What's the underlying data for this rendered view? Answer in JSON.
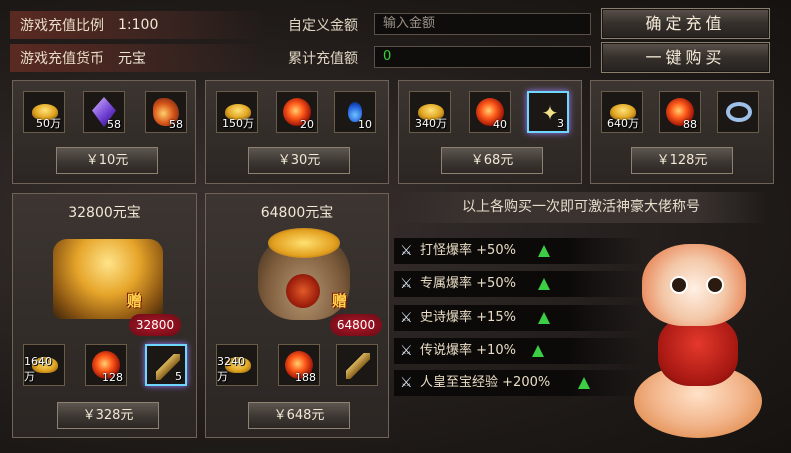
{
  "header": {
    "ratio_label": "游戏充值比例",
    "ratio_value": "1:100",
    "currency_label": "游戏充值货币",
    "currency_value": "元宝",
    "custom_amount_label": "自定义金额",
    "custom_amount_placeholder": "输入金额",
    "total_label": "累计充值额",
    "total_value": "0",
    "confirm_button": "确定充值",
    "buy_all_button": "一键购买"
  },
  "top_packs": [
    {
      "items": [
        {
          "icon": "gold-ingot-icon",
          "count": "50万"
        },
        {
          "icon": "purple-crystal-icon",
          "count": "58"
        },
        {
          "icon": "flame-orb-icon",
          "count": "58"
        }
      ],
      "price": "￥10元"
    },
    {
      "items": [
        {
          "icon": "gold-ingot-icon",
          "count": "150万"
        },
        {
          "icon": "fire-orb-icon",
          "count": "20"
        },
        {
          "icon": "blue-potion-icon",
          "count": "10"
        }
      ],
      "price": "￥30元"
    },
    {
      "items": [
        {
          "icon": "gold-ingot-icon",
          "count": "340万"
        },
        {
          "icon": "fire-orb-icon",
          "count": "40"
        },
        {
          "icon": "star-charm-icon",
          "count": "3"
        }
      ],
      "price": "￥68元"
    },
    {
      "items": [
        {
          "icon": "gold-ingot-icon",
          "count": "640万"
        },
        {
          "icon": "fire-orb-icon",
          "count": "88"
        },
        {
          "icon": "silver-ring-icon",
          "count": ""
        }
      ],
      "price": "￥128元"
    }
  ],
  "big_packs": [
    {
      "title": "32800元宝",
      "gift_tag": "赠",
      "gift_value": "32800",
      "items": [
        {
          "icon": "gold-ingot-icon",
          "count": "1640万"
        },
        {
          "icon": "fire-orb-icon",
          "count": "128"
        },
        {
          "icon": "scroll-icon",
          "count": "5"
        }
      ],
      "price": "￥328元"
    },
    {
      "title": "64800元宝",
      "gift_tag": "赠",
      "gift_value": "64800",
      "items": [
        {
          "icon": "gold-ingot-icon",
          "count": "3240万"
        },
        {
          "icon": "fire-orb-icon",
          "count": "188"
        },
        {
          "icon": "scroll-icon",
          "count": ""
        }
      ],
      "price": "￥648元"
    }
  ],
  "bonus": {
    "heading": "以上各购买一次即可激活神豪大佬称号",
    "rows": [
      {
        "label": "打怪爆率",
        "value": "+50%"
      },
      {
        "label": "专属爆率",
        "value": "+50%"
      },
      {
        "label": "史诗爆率",
        "value": "+15%"
      },
      {
        "label": "传说爆率",
        "value": "+10%"
      },
      {
        "label": "人皇至宝经验",
        "value": "+200%"
      }
    ]
  },
  "colors": {
    "accent_green": "#39d23a",
    "arrow_green": "#3ccf45",
    "glow_border": "#6fd6ff"
  }
}
